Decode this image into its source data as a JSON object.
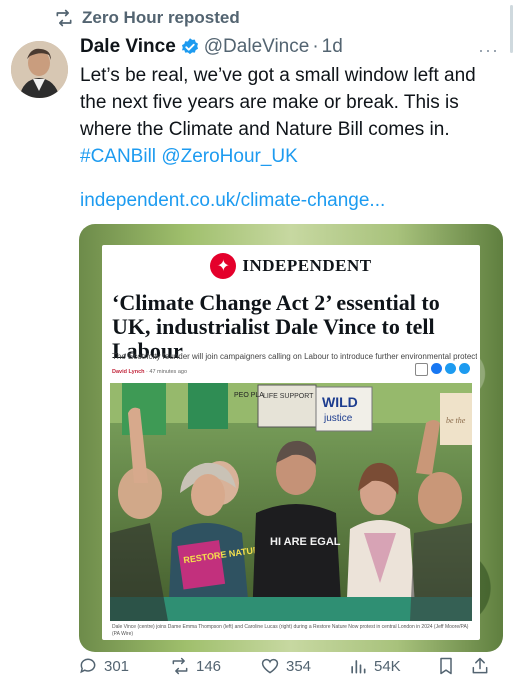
{
  "repost": {
    "label": "Zero Hour reposted",
    "icon": "repost-icon"
  },
  "author": {
    "name": "Dale Vince",
    "handle": "@DaleVince",
    "separator": "·",
    "time": "1d",
    "verified_color": "#1d9bf0"
  },
  "more": "···",
  "tweet": {
    "text": "Let’s be real, we’ve got a small window left and the next five years are make or break. This is where the Climate and Nature Bill comes in.",
    "hashtag": "#CANBill",
    "mention": "@ZeroHour_UK"
  },
  "link_url": "independent.co.uk/climate-change...",
  "article": {
    "publication": "INDEPENDENT",
    "headline": "‘Climate Change Act 2’ essential to UK, industrialist Dale Vince to tell Labour",
    "standfirst": "The Ecotricity founder will join campaigners calling on Labour to introduce further environmental protections.",
    "author": "David Lynch",
    "time": "47 minutes ago",
    "photo_signs": {
      "life_support": "LIFE SUPPORT SYSTEM",
      "wild": "WILD",
      "justice": "justice",
      "restore": "RESTORE NATURE NOW",
      "shirt": "HI ARE EGAL",
      "be_the": "be the",
      "peo": "PEO PLA"
    },
    "caption": "Dale Vince (centre) joins Dame Emma Thompson (left) and Caroline Lucas (right) during a Restore Nature Now protest in central London in 2024 (Jeff Moore/PA) (PA Wire)"
  },
  "actions": {
    "replies": "301",
    "reposts": "146",
    "likes": "354",
    "views": "54K"
  },
  "colors": {
    "accent": "#1d9bf0",
    "muted": "#536471",
    "repost_green": "#00ba7c",
    "brand_red": "#e4002b"
  }
}
